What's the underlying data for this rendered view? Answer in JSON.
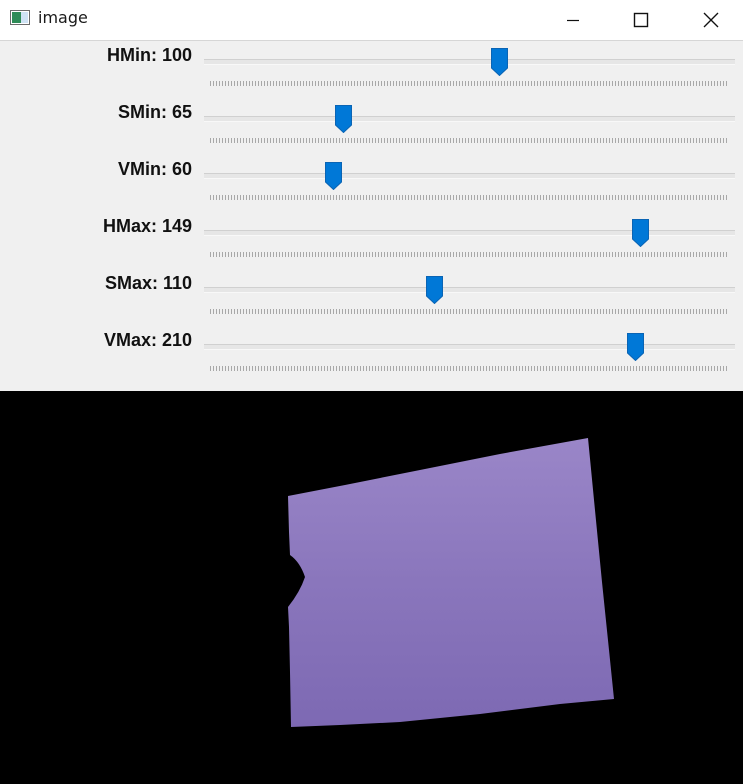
{
  "window": {
    "title": "image",
    "icons": {
      "app": "window-image-icon",
      "minimize": "minimize-icon",
      "maximize": "maximize-icon",
      "close": "close-icon"
    }
  },
  "trackbars": [
    {
      "label": "HMin: 100",
      "value": 100,
      "max": 179
    },
    {
      "label": "SMin: 65",
      "value": 65,
      "max": 255
    },
    {
      "label": "VMin: 60",
      "value": 60,
      "max": 255
    },
    {
      "label": "HMax: 149",
      "value": 149,
      "max": 179
    },
    {
      "label": "SMax: 110",
      "value": 110,
      "max": 255
    },
    {
      "label": "VMax: 210",
      "value": 210,
      "max": 255
    }
  ],
  "colors": {
    "thumb": "#0078d7",
    "panel_bg": "#f0f0f0",
    "mask_bg": "#000000",
    "object_light": "#9a86c8",
    "object_dark": "#7e6ab4"
  },
  "image": {
    "content": "masked-purple-object"
  }
}
